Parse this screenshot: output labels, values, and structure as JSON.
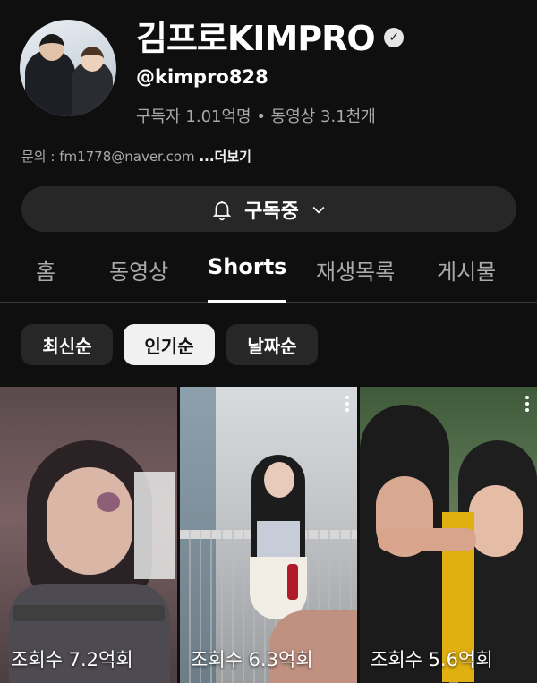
{
  "channel": {
    "name": "김프로KIMPRO",
    "handle": "@kimpro828",
    "stats": "구독자 1.01억명 • 동영상 3.1천개",
    "contact": "문의 : fm1778@naver.com",
    "more_label": "...더보기",
    "verified_icon": "check-circle-icon"
  },
  "subscribe": {
    "label": "구독중",
    "icon": "bell-icon",
    "dropdown_icon": "chevron-down-icon"
  },
  "tabs": [
    {
      "label": "홈"
    },
    {
      "label": "동영상"
    },
    {
      "label": "Shorts",
      "active": true
    },
    {
      "label": "재생목록"
    },
    {
      "label": "게시물"
    }
  ],
  "sort_chips": [
    {
      "label": "최신순"
    },
    {
      "label": "인기순",
      "selected": true
    },
    {
      "label": "날짜순"
    }
  ],
  "shorts": [
    {
      "views": "조회수 7.2억회"
    },
    {
      "views": "조회수 6.3억회"
    },
    {
      "views": "조회수 5.6억회"
    }
  ],
  "colors": {
    "background": "#0f0f0f",
    "chip": "#272727",
    "chip_selected": "#f1f1f1",
    "text_secondary": "#aaaaaa"
  }
}
